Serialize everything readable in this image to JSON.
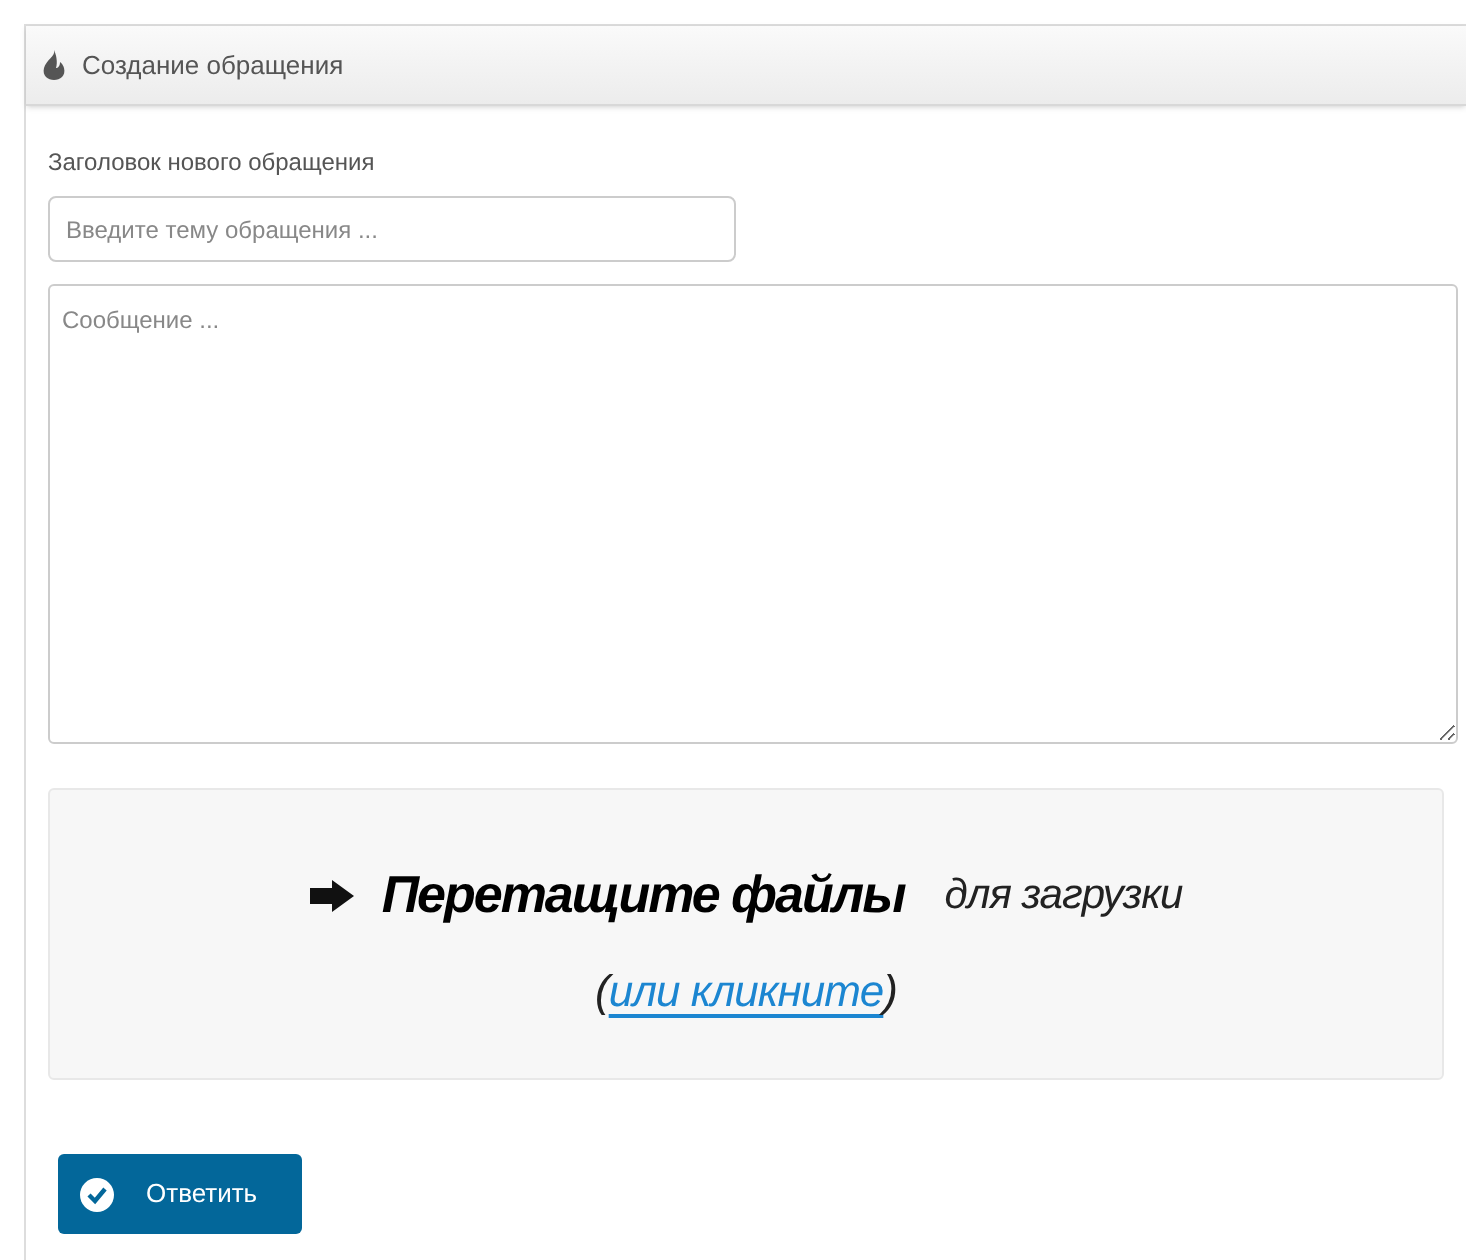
{
  "panel": {
    "title": "Создание обращения"
  },
  "form": {
    "subject_label": "Заголовок нового обращения",
    "subject_placeholder": "Введите тему обращения ...",
    "message_placeholder": "Сообщение ..."
  },
  "dropzone": {
    "title": "Перетащите файлы",
    "subtitle": "для загрузки",
    "link_prefix": "(",
    "link": "или кликните",
    "link_suffix": ")"
  },
  "submit_button": {
    "label": "Ответить"
  }
}
